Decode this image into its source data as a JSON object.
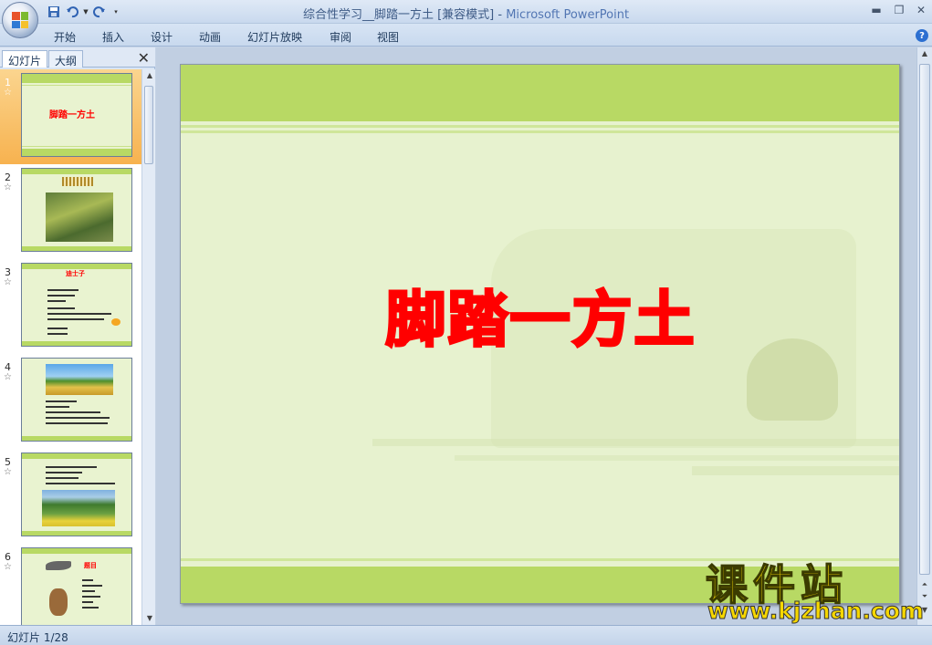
{
  "window": {
    "title_doc": "综合性学习__脚踏一方土 [兼容模式]",
    "title_sep": " - ",
    "title_app": "Microsoft PowerPoint"
  },
  "ribbon": {
    "tabs": [
      "开始",
      "插入",
      "设计",
      "动画",
      "幻灯片放映",
      "审阅",
      "视图"
    ]
  },
  "panel": {
    "tabs": [
      "幻灯片",
      "大纲"
    ],
    "close": "✕"
  },
  "thumbnails": [
    {
      "num": "1",
      "title": "脚踏一方土"
    },
    {
      "num": "2",
      "title": ""
    },
    {
      "num": "3",
      "title": "迪士子"
    },
    {
      "num": "4",
      "title": ""
    },
    {
      "num": "5",
      "title": ""
    },
    {
      "num": "6",
      "title": "题目"
    }
  ],
  "slide": {
    "title": "脚踏一方土",
    "colors": {
      "band": "#b8d964",
      "background": "#e7f2cf",
      "title": "#ff0000"
    }
  },
  "watermark": {
    "name": "课件站",
    "url": "www.kjzhan.com"
  },
  "status": {
    "slide_counter": "幻灯片 1/28"
  }
}
